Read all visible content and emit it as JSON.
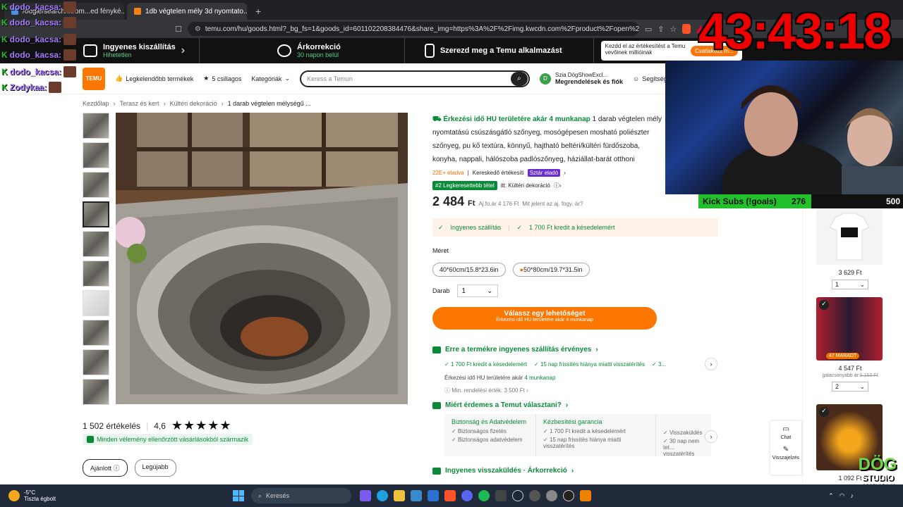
{
  "browser": {
    "tabs": [
      {
        "label": "/oogle/search/.../om...ed fényké..."
      },
      {
        "label": "1db végtelen mély 3d nyomtato..."
      }
    ],
    "url": "temu.com/hu/goods.html?_bg_fs=1&goods_id=601102208384476&share_img=https%3A%2F%2Fimg.kwcdn.com%2Fproduct%2Fopen%2F34f..."
  },
  "promo": {
    "free_shipping_title": "Ingyenes kiszállítás",
    "free_shipping_sub": "Hihetetlen",
    "price_adjust_title": "Árkorrekció",
    "price_adjust_sub": "30 napon belül",
    "app_title": "Szerezd meg a Temu alkalmazást",
    "notify_text": "Kezdd el az értékesítést a Temu vevőinek millióinak",
    "notify_cta": "Csatlakozz m..."
  },
  "header": {
    "logo": "TEMU",
    "best_sellers": "Legkelendőbb termékek",
    "five_stars": "5 csillagos",
    "categories": "Kategóriák",
    "search_placeholder": "Keress a Temun",
    "greeting": "Szia DögShowExcl...",
    "orders": "Megrendelések és fiók",
    "help": "Segítség",
    "account_initial": "D"
  },
  "breadcrumb": [
    "Kezdőlap",
    "Terasz és kert",
    "Kültéri dekoráció",
    "1 darab végtelen mélységű ..."
  ],
  "product": {
    "delivery_lead": "Érkezési idő HU területére akár 4 munkanap",
    "title": "1 darab végtelen mély nyomtatású csúszásgátló szőnyeg, mosógépesen mosható poliészter szőnyeg, pu kő textúra, könnyű, hajtható beltéri/kültéri fürdőszoba, konyha, nappali, hálószoba padlószőnyeg, háziállat-barát otthoni dekoráció, tartós padlóburkolat",
    "sold": "22E+ eladva",
    "seller_rating": "Kereskedő értékesíti",
    "star_seller": "Sztár eladó",
    "rank_tag": "#2 Legkeresettebb tétel",
    "rank_in": "itt: Kültéri dekoráció",
    "price": "2 484",
    "currency": "Ft",
    "old_price": "Aj.fo.ár 4 176 Ft",
    "old_price_help": "Mit jelent az aj. fogy. ár?",
    "shipping_free": "Ingyenes szállítás",
    "late_credit": "1 700 Ft kredit a késedelemért",
    "size_label": "Méret",
    "sizes": [
      "40*60cm/15.8*23.6in",
      "50*80cm/19.7*31.5in"
    ],
    "qty_label": "Darab",
    "qty_value": "1",
    "cta_main": "Válassz egy lehetőséget",
    "cta_sub": "Érkezési idő HU területére akár 4 munkanap"
  },
  "ratings": {
    "count": "1 502 értékelés",
    "score": "4,6",
    "stars": "★★★★★",
    "verified": "Minden vélemény ellenőrzött vásárlásokból származik",
    "recommended": "Ajánlott",
    "newest": "Legújabb"
  },
  "shipping_section": {
    "heading": "Erre a termékre ingyenes szállítás érvényes",
    "items": [
      "1 700 Ft kredit a késedelemért",
      "15 nap frissítés hiánya miatti visszatérítés",
      "3..."
    ],
    "arrival_prefix": "Érkezési idő HU területére akár",
    "arrival_highlight": "4 munkanap",
    "min_order": "Min. rendelési érték: 3 500 Ft"
  },
  "why_section": {
    "heading": "Miért érdemes a Temut választani?",
    "col1_title": "Biztonság és Adatvédelem",
    "col1_items": [
      "Biztonságos fizetés",
      "Biztonságos adatvédelem"
    ],
    "col2_title": "Kézbesítési garancia",
    "col2_items": [
      "1 700 Ft kredit a késedelemért",
      "15 nap frissítés hiánya miatti visszatérítés"
    ],
    "col3_items": [
      "Visszaküldés",
      "30 nap nem tet... visszatérítés"
    ]
  },
  "returns_heading": "Ingyenes visszaküldés · Árkorrekció",
  "side_products": [
    {
      "price": "3 629 Ft",
      "qty": "1"
    },
    {
      "price": "4 547 Ft",
      "old": "galacsonyabb ár:",
      "old_strike": "5 163 Ft",
      "badge": "47 MARADT",
      "qty": "2"
    },
    {
      "price": "1 092 Ft"
    }
  ],
  "side_widgets": {
    "chat": "Chat",
    "returns": "Visszajelzés"
  },
  "stream": {
    "chat": [
      {
        "user": "dodo_kacsa:"
      },
      {
        "user": "dodo_kacsa:"
      },
      {
        "user": "dodo_kacsa:"
      },
      {
        "user": "dodo_kacsa:"
      },
      {
        "user": "dodo_kacsa:"
      },
      {
        "user": "Zodykaa:"
      }
    ],
    "timer": "43:43:18",
    "subs_label": "Kick Subs (!goals)",
    "subs_current": "276",
    "subs_goal": "500",
    "subs_progress": 0.552,
    "logo_l1": "DÖG",
    "logo_l2": "STUDIO",
    "logo_l3": "MARATON"
  },
  "taskbar": {
    "temp": "-5°C",
    "weather": "Tiszta égbolt",
    "search": "Keresés"
  },
  "colors": {
    "accent": "#fb7701",
    "green": "#0a8a39",
    "timer": "#ee0000"
  }
}
